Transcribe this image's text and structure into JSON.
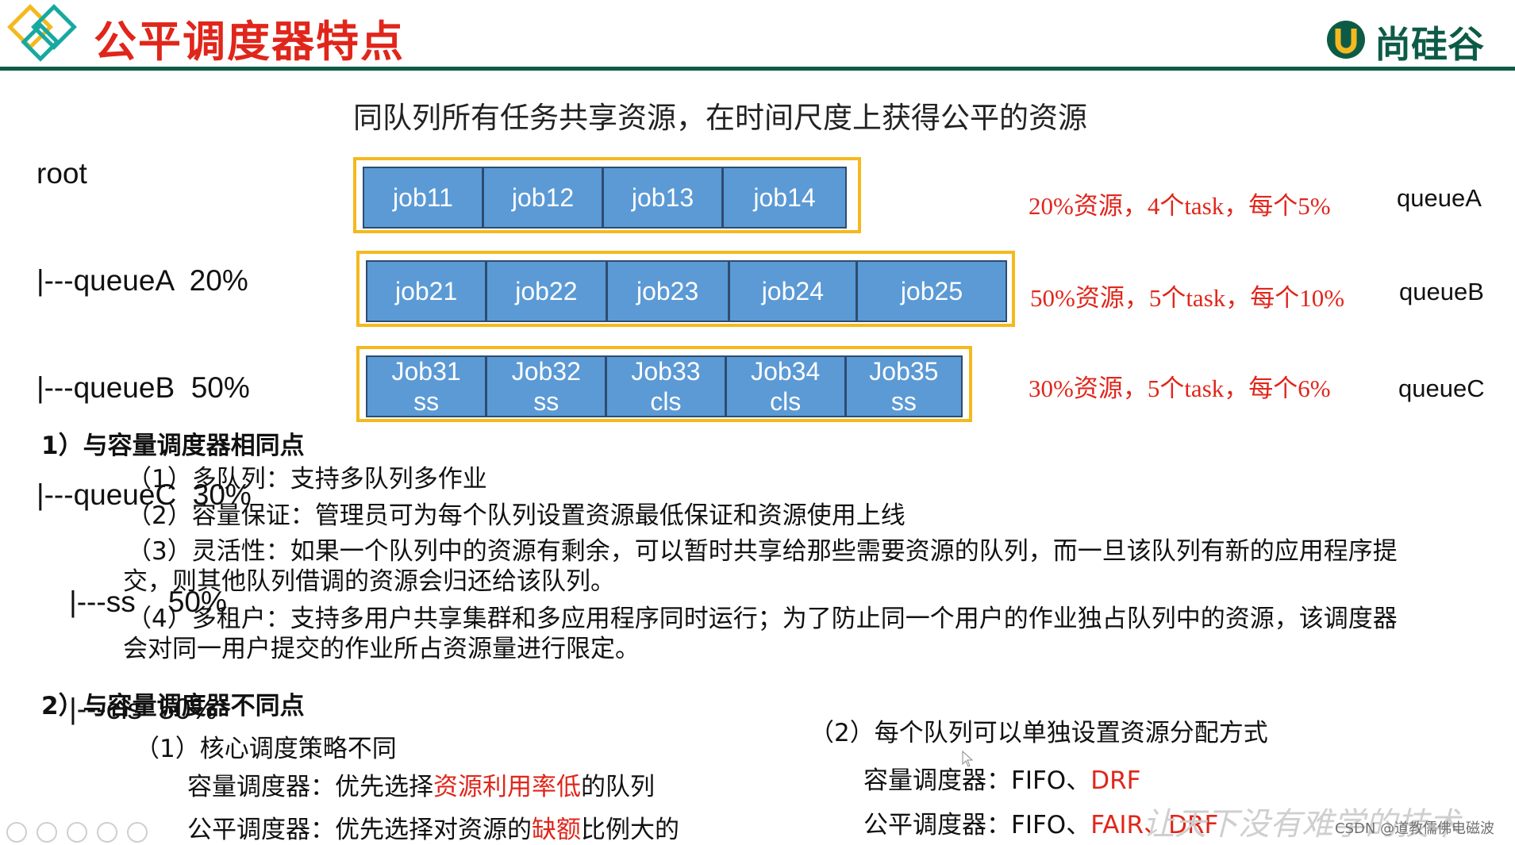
{
  "header": {
    "title": "公平调度器特点",
    "logo_text": "尚硅谷",
    "accent": "#e0261b",
    "brand": "#0d5b46"
  },
  "tree": [
    "root",
    "|---queueA  20%",
    "|---queueB  50%",
    "|---queueC  30%",
    "    |---ss    50%",
    "    |---cls  50%"
  ],
  "subtitle": "同队列所有任务共享资源，在时间尺度上获得公平的资源",
  "queues": [
    {
      "jobs": [
        {
          "l1": "job11",
          "l2": ""
        },
        {
          "l1": "job12",
          "l2": ""
        },
        {
          "l1": "job13",
          "l2": ""
        },
        {
          "l1": "job14",
          "l2": ""
        }
      ],
      "note": "20%资源，4个task，每个5%",
      "name": "queueA"
    },
    {
      "jobs": [
        {
          "l1": "job21",
          "l2": ""
        },
        {
          "l1": "job22",
          "l2": ""
        },
        {
          "l1": "job23",
          "l2": ""
        },
        {
          "l1": "job24",
          "l2": ""
        },
        {
          "l1": "job25",
          "l2": ""
        }
      ],
      "note": "50%资源，5个task，每个10%",
      "name": "queueB"
    },
    {
      "jobs": [
        {
          "l1": "Job31",
          "l2": "ss"
        },
        {
          "l1": "Job32",
          "l2": "ss"
        },
        {
          "l1": "Job33",
          "l2": "cls"
        },
        {
          "l1": "Job34",
          "l2": "cls"
        },
        {
          "l1": "Job35",
          "l2": "ss"
        }
      ],
      "note": "30%资源，5个task，每个6%",
      "name": "queueC"
    }
  ],
  "colors": {
    "job_fill": "#5b9ad5",
    "box_border": "#f4b91e",
    "job_border": "#2d4c70"
  },
  "same": {
    "heading": "1）与容量调度器相同点",
    "item1": "（1）多队列：支持多队列多作业",
    "item2": "（2）容量保证：管理员可为每个队列设置资源最低保证和资源使用上线",
    "item3_line1": "（3）灵活性：如果一个队列中的资源有剩余，可以暂时共享给那些需要资源的队列，而一旦该队列有新的应用程序提",
    "item3_line2": "交，则其他队列借调的资源会归还给该队列。",
    "item4_line1": "（4）多租户：支持多用户共享集群和多应用程序同时运行；为了防止同一个用户的作业独占队列中的资源，该调度器",
    "item4_line2": "会对同一用户提交的作业所占资源量进行限定。"
  },
  "diff": {
    "heading": "2）与容量调度器不同点",
    "left_title": "（1）核心调度策略不同",
    "cap_prefix": "容量调度器：优先选择",
    "cap_red": "资源利用率低",
    "cap_suffix": "的队列",
    "fair_prefix": "公平调度器：优先选择对资源的",
    "fair_red": "缺额",
    "fair_suffix": "比例大的",
    "right_title": "（2）每个队列可以单独设置资源分配方式",
    "cap2_prefix": "容量调度器：FIFO、",
    "cap2_red": "DRF",
    "fair2_prefix": "公平调度器：FIFO、",
    "fair2_red": "FAIR、DRF"
  },
  "watermark": "让天下没有难学的技术",
  "csdn": "CSDN @道教儒佛电磁波"
}
